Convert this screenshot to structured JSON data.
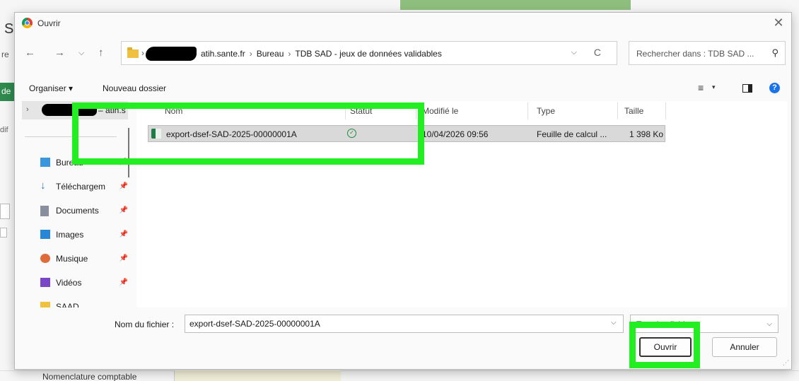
{
  "background": {
    "letter": "S",
    "re_text": "re",
    "de_text": "de",
    "dif_text": "dif",
    "bottom_label": "Nomenclature comptable"
  },
  "dialog": {
    "title": "Ouvrir",
    "close_glyph": "✕",
    "nav": {
      "back_glyph": "←",
      "forward_glyph": "→",
      "recent_glyph": "⌵",
      "up_glyph": "↑",
      "breadcrumb": [
        "atih.sante.fr",
        "Bureau",
        "TDB SAD - jeux de données validables"
      ],
      "breadcrumb_sep": "›",
      "expand_glyph": "›",
      "dropdown_glyph": "⌵",
      "refresh_glyph": "C",
      "search_placeholder": "Rechercher dans : TDB SAD ...",
      "search_glyph": "⚲"
    },
    "commandbar": {
      "organize": "Organiser ▾",
      "new_folder": "Nouveau dossier",
      "view_glyph": "≡",
      "view_chev": "▾",
      "help_glyph": "?"
    },
    "leftpane": {
      "top_label": "– atih.s",
      "top_chev": "›",
      "pin_glyph": "📌",
      "items": [
        {
          "label": "Bureau",
          "icon_color": "#3a96dd"
        },
        {
          "label": "Téléchargem",
          "icon_color": "#2a7ab0"
        },
        {
          "label": "Documents",
          "icon_color": "#8a8fa0"
        },
        {
          "label": "Images",
          "icon_color": "#2a86d6"
        },
        {
          "label": "Musique",
          "icon_color": "#e06b3a"
        },
        {
          "label": "Vidéos",
          "icon_color": "#7a46c8"
        },
        {
          "label": "SAAD",
          "icon_color": "#f0c040"
        }
      ],
      "download_glyph": "↓"
    },
    "filelist": {
      "columns": [
        "Nom",
        "Statut",
        "Modifié le",
        "Type",
        "Taille"
      ],
      "rows": [
        {
          "name": "export-dsef-SAD-2025-00000001A",
          "status": "✓",
          "modified": "10/04/2026 09:56",
          "type": "Feuille de calcul ...",
          "size": "1 398 Ko"
        }
      ]
    },
    "footer": {
      "filename_label": "Nom du fichier :",
      "filename_value": "export-dsef-SAD-2025-00000001A",
      "filename_chev": "⌵",
      "filter_value": "Tous les fichiers",
      "filter_chev": "⌵",
      "open_label": "Ouvrir",
      "cancel_label": "Annuler",
      "grip": "⋰"
    }
  },
  "highlight_color": "#22ee22"
}
